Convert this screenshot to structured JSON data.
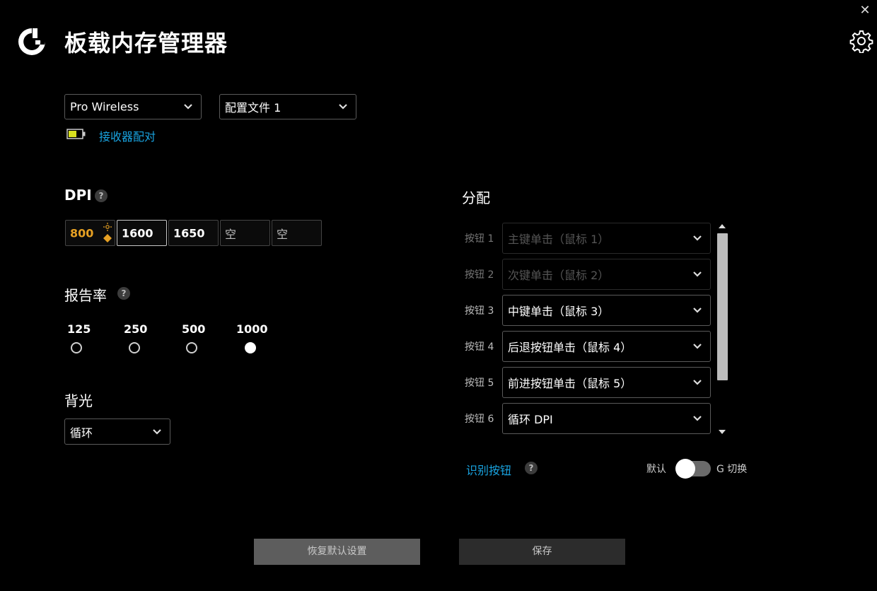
{
  "header": {
    "title": "板载内存管理器",
    "close_glyph": "✕",
    "icons": [
      "logitech-g-logo",
      "gear-icon",
      "close-icon"
    ]
  },
  "device_select": {
    "value": "Pro Wireless"
  },
  "profile_select": {
    "value": "配置文件 1"
  },
  "receiver": {
    "pair_label": "接收器配对",
    "battery_color": "#d8e020"
  },
  "dpi": {
    "title": "DPI",
    "help": "?",
    "slots": [
      "800",
      "1600",
      "1650",
      "空",
      "空"
    ],
    "current_color": "#e6a023"
  },
  "report_rate": {
    "title": "报告率",
    "help": "?",
    "options": [
      "125",
      "250",
      "500",
      "1000"
    ],
    "selected": "1000"
  },
  "backlight": {
    "title": "背光",
    "value": "循环"
  },
  "assignments": {
    "title": "分配",
    "rows": [
      {
        "label": "按钮 1",
        "value": "主键单击（鼠标 1）"
      },
      {
        "label": "按钮 2",
        "value": "次键单击（鼠标 2）"
      },
      {
        "label": "按钮 3",
        "value": "中键单击（鼠标 3）"
      },
      {
        "label": "按钮 4",
        "value": "后退按钮单击（鼠标 4）"
      },
      {
        "label": "按钮 5",
        "value": "前进按钮单击（鼠标 5）"
      },
      {
        "label": "按钮 6",
        "value": "循环 DPI"
      }
    ],
    "identify_label": "识别按钮",
    "help": "?",
    "toggle_left": "默认",
    "toggle_right": "G 切换"
  },
  "footer": {
    "restore_label": "恢复默认设置",
    "save_label": "保存"
  },
  "colors": {
    "accent": "#19a3e0",
    "background": "#000000"
  }
}
